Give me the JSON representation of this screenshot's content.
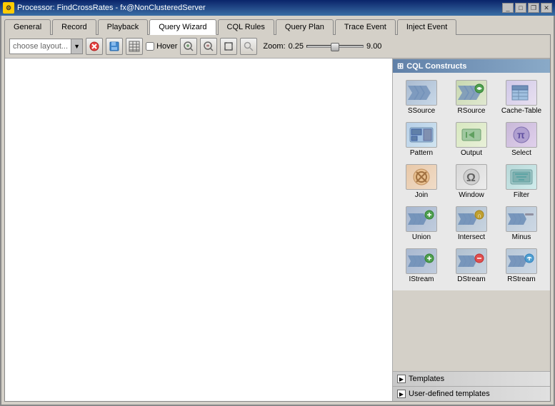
{
  "titlebar": {
    "title": "Processor: FindCrossRates - fx@NonClusteredServer",
    "controls": [
      "minimize",
      "maximize",
      "restore",
      "close"
    ]
  },
  "tabs": [
    {
      "id": "general",
      "label": "General",
      "active": false
    },
    {
      "id": "record",
      "label": "Record",
      "active": false
    },
    {
      "id": "playback",
      "label": "Playback",
      "active": false
    },
    {
      "id": "querywizard",
      "label": "Query Wizard",
      "active": true
    },
    {
      "id": "cqlrules",
      "label": "CQL Rules",
      "active": false
    },
    {
      "id": "queryplan",
      "label": "Query Plan",
      "active": false
    },
    {
      "id": "traceevent",
      "label": "Trace Event",
      "active": false
    },
    {
      "id": "injectevent",
      "label": "Inject Event",
      "active": false
    }
  ],
  "toolbar": {
    "layout_placeholder": "choose layout...",
    "hover_label": "Hover",
    "zoom_label": "Zoom:",
    "zoom_min": "0.25",
    "zoom_max": "9.00"
  },
  "cql_constructs": {
    "header": "CQL Constructs",
    "items": [
      {
        "id": "ssource",
        "label": "SSource"
      },
      {
        "id": "rsource",
        "label": "RSource"
      },
      {
        "id": "cachetable",
        "label": "Cache-Table"
      },
      {
        "id": "pattern",
        "label": "Pattern"
      },
      {
        "id": "output",
        "label": "Output"
      },
      {
        "id": "select",
        "label": "Select"
      },
      {
        "id": "join",
        "label": "Join"
      },
      {
        "id": "window",
        "label": "Window"
      },
      {
        "id": "filter",
        "label": "Filter"
      },
      {
        "id": "union",
        "label": "Union"
      },
      {
        "id": "intersect",
        "label": "Intersect"
      },
      {
        "id": "minus",
        "label": "Minus"
      },
      {
        "id": "istream",
        "label": "IStream"
      },
      {
        "id": "dstream",
        "label": "DStream"
      },
      {
        "id": "rstream",
        "label": "RStream"
      }
    ]
  },
  "templates": {
    "label": "Templates",
    "user_defined_label": "User-defined templates"
  }
}
